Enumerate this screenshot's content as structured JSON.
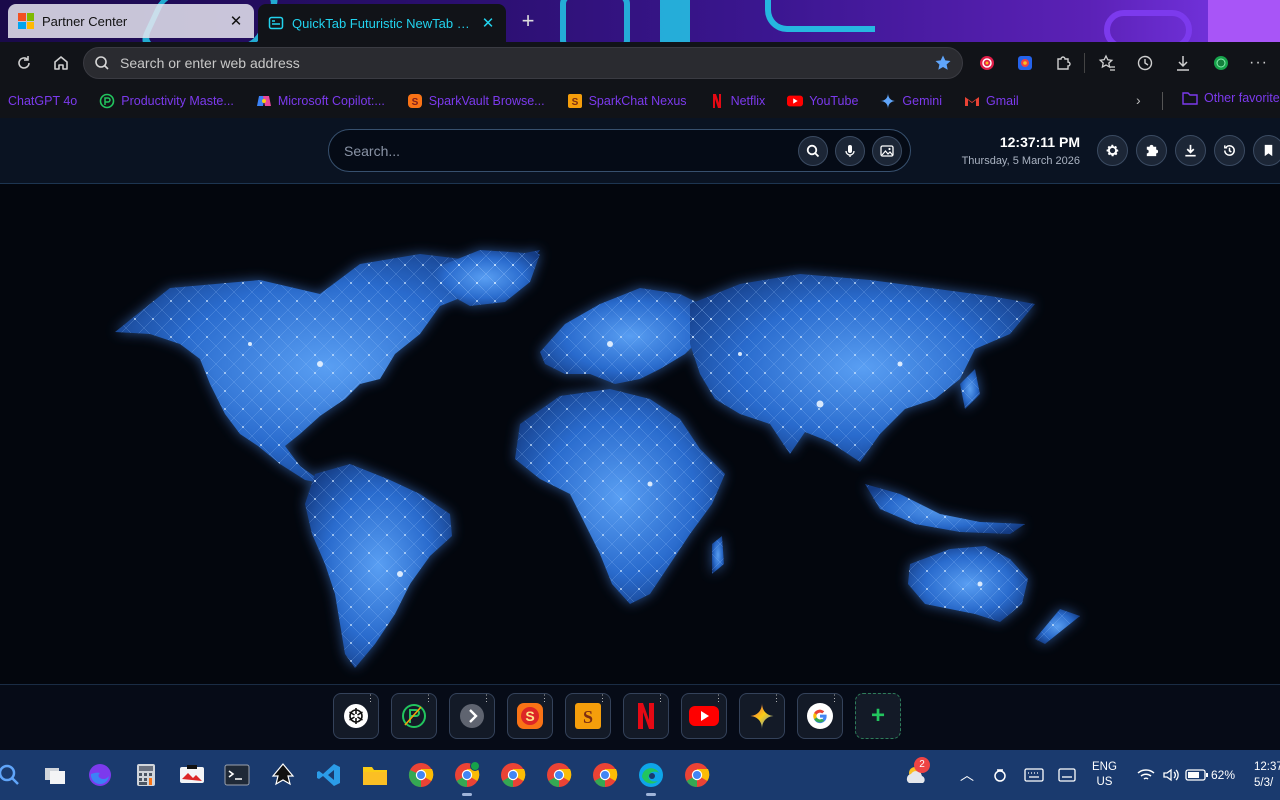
{
  "tabs": [
    {
      "title": "Partner Center",
      "active": false
    },
    {
      "title": "QuickTab Futuristic NewTab Dashboard",
      "active": true
    }
  ],
  "toolbar": {
    "address_placeholder": "Search or enter web address"
  },
  "bookmarks": [
    {
      "label": "ChatGPT 4o",
      "icon": "none"
    },
    {
      "label": "Productivity Maste...",
      "icon": "productivity-icon"
    },
    {
      "label": "Microsoft Copilot:...",
      "icon": "copilot-icon"
    },
    {
      "label": "SparkVault Browse...",
      "icon": "sparkvault-icon"
    },
    {
      "label": "SparkChat Nexus",
      "icon": "sparkchat-icon"
    },
    {
      "label": "Netflix",
      "icon": "netflix-icon"
    },
    {
      "label": "YouTube",
      "icon": "youtube-icon"
    },
    {
      "label": "Gemini",
      "icon": "gemini-icon"
    },
    {
      "label": "Gmail",
      "icon": "gmail-icon"
    }
  ],
  "bookmarks_other": "Other favorites",
  "page": {
    "search_placeholder": "Search...",
    "time": "12:37:11 PM",
    "date": "Thursday, 5 March 2026"
  },
  "dock": [
    "chatgpt-icon",
    "productivity-icon",
    "arrow-icon",
    "sparkvault-icon",
    "sparkchat-icon",
    "netflix-icon",
    "youtube-icon",
    "gemini-icon",
    "google-icon",
    "add-icon"
  ],
  "taskbar": {
    "lang_line1": "ENG",
    "lang_line2": "US",
    "battery": "62%",
    "clock_time": "12:37",
    "clock_date": "5/3/",
    "weather_badge": "2"
  },
  "colors": {
    "accent_cyan": "#22d3ee",
    "bookmark_text": "#7c3aed",
    "taskbar": "#1a3a6e"
  }
}
